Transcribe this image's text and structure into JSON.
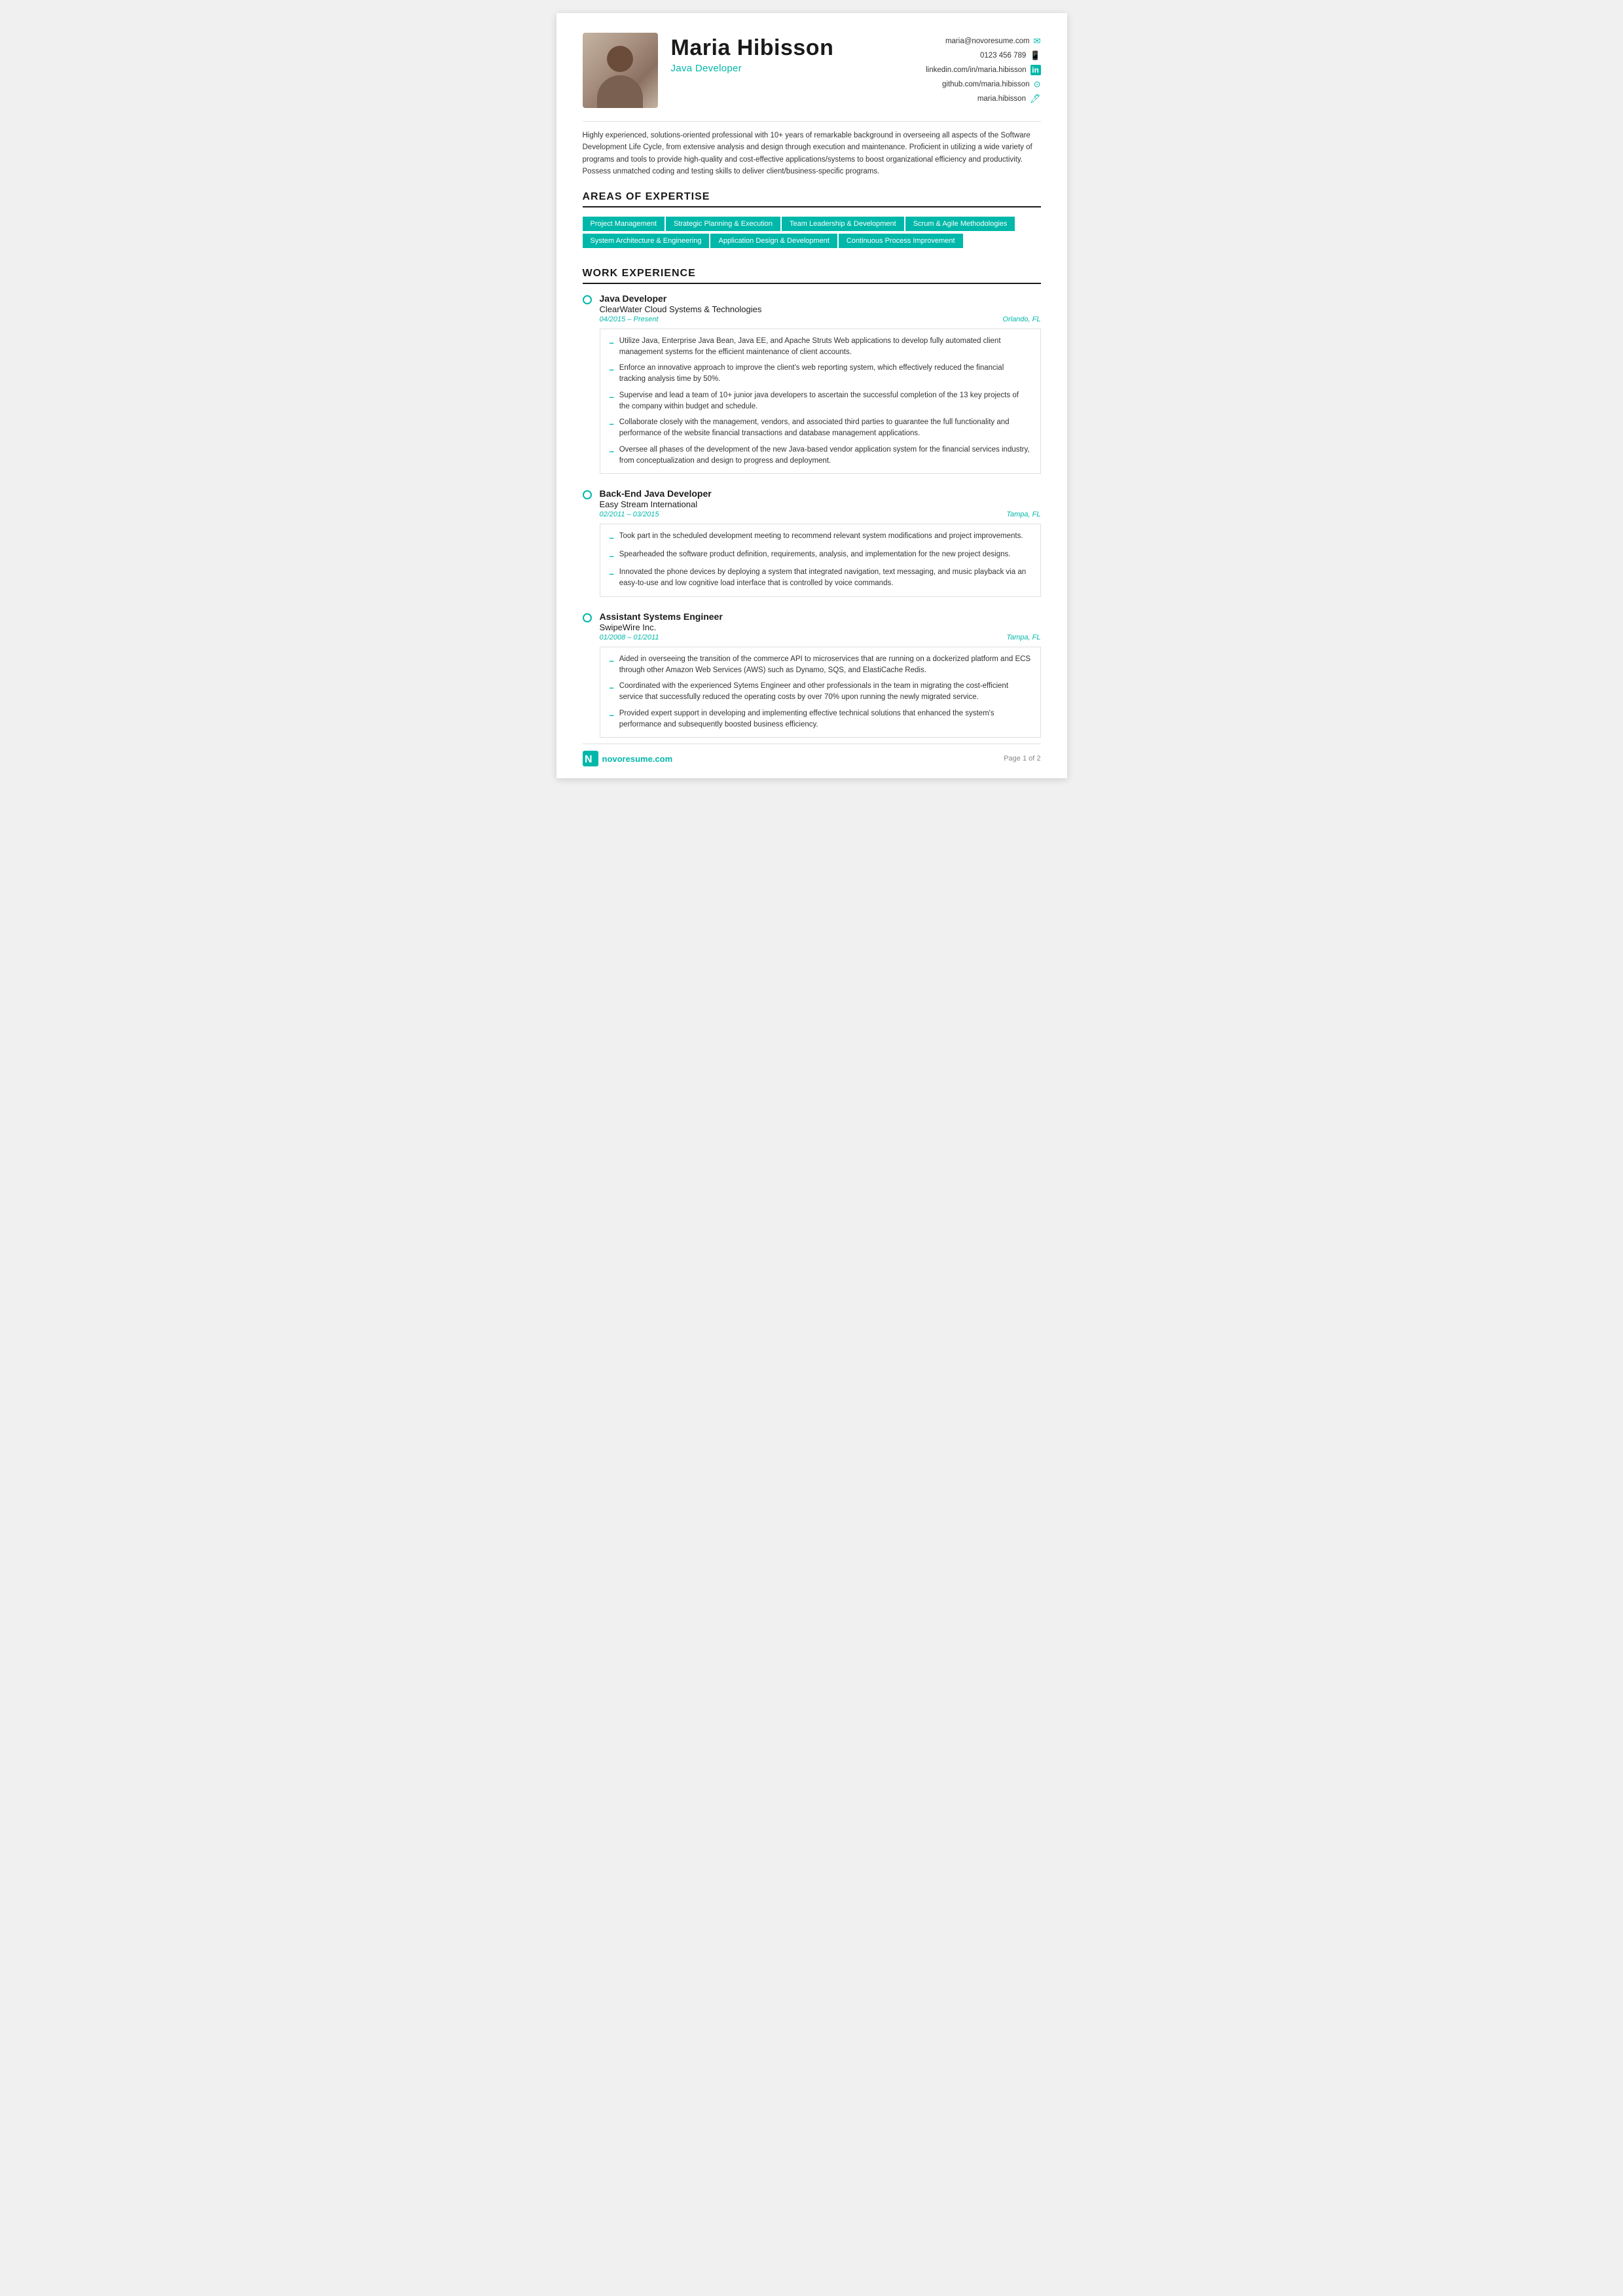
{
  "header": {
    "name": "Maria Hibisson",
    "job_title": "Java Developer",
    "contact": {
      "email": "maria@novoresume.com",
      "phone": "0123 456 789",
      "linkedin": "linkedin.com/in/maria.hibisson",
      "github": "github.com/maria.hibisson",
      "website": "maria.hibisson"
    }
  },
  "summary": "Highly experienced, solutions-oriented professional with 10+ years of remarkable background in overseeing all aspects of the Software Development Life Cycle, from extensive analysis and design through execution and maintenance. Proficient in utilizing a wide variety of programs and tools to provide high-quality and cost-effective applications/systems to boost organizational efficiency and productivity. Possess unmatched coding and testing skills to deliver client/business-specific programs.",
  "expertise": {
    "section_title": "AREAS OF EXPERTISE",
    "tags_row1": [
      "Project Management",
      "Strategic Planning & Execution",
      "Team Leadership & Development",
      "Scrum & Agile Methodologies"
    ],
    "tags_row2": [
      "System Architecture & Engineering",
      "Application Design & Development",
      "Continuous Process Improvement"
    ]
  },
  "work_experience": {
    "section_title": "WORK EXPERIENCE",
    "jobs": [
      {
        "title": "Java Developer",
        "company": "ClearWater Cloud Systems & Technologies",
        "dates": "04/2015 – Present",
        "location": "Orlando, FL",
        "bullets": [
          "Utilize Java, Enterprise Java Bean, Java EE, and Apache Struts Web applications to develop fully automated client management systems for the efficient maintenance of client accounts.",
          "Enforce an innovative approach to improve the client's web reporting system, which effectively reduced the financial tracking analysis time by 50%.",
          "Supervise and lead a team of 10+ junior java developers to ascertain the successful completion of the 13 key projects of the company within budget and schedule.",
          "Collaborate closely with the management, vendors, and associated third parties to guarantee the full functionality and performance of the website financial transactions and database management applications.",
          "Oversee all phases of the development of the new Java-based vendor application system for the financial services industry, from conceptualization and design to progress and deployment."
        ]
      },
      {
        "title": "Back-End Java Developer",
        "company": "Easy Stream International",
        "dates": "02/2011 – 03/2015",
        "location": "Tampa, FL",
        "bullets": [
          "Took part in the scheduled development meeting to recommend relevant system modifications and project improvements.",
          "Spearheaded the software product definition, requirements, analysis, and implementation for the new project designs.",
          "Innovated the phone devices by deploying a system that integrated navigation, text messaging, and music playback via an easy-to-use and low cognitive load interface that is controlled by voice commands."
        ]
      },
      {
        "title": "Assistant Systems Engineer",
        "company": "SwipeWire Inc.",
        "dates": "01/2008 – 01/2011",
        "location": "Tampa, FL",
        "bullets": [
          "Aided in overseeing the transition of the commerce API to microservices that are running on a dockerized platform and ECS through other Amazon Web Services (AWS) such as Dynamo, SQS, and ElastiCache Redis.",
          "Coordinated with the experienced Sytems Engineer and other professionals in the team in migrating the cost-efficient service that successfully reduced the operating costs by over 70% upon running the newly migrated service.",
          "Provided expert support in developing and implementing effective technical solutions that enhanced the system's performance and subsequently boosted business efficiency."
        ]
      }
    ]
  },
  "footer": {
    "logo_text": "novoresume.com",
    "page_label": "Page 1 of 2"
  }
}
